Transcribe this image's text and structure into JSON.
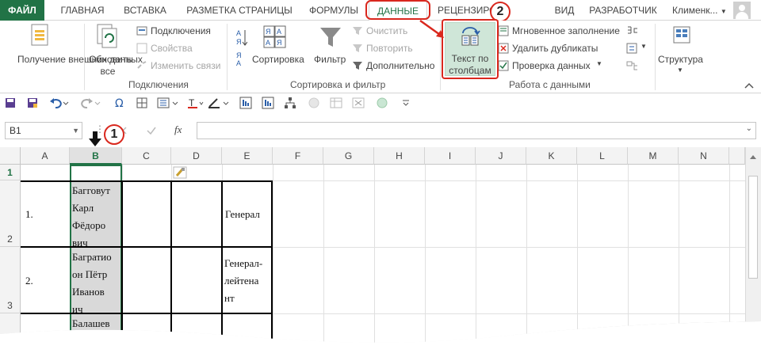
{
  "ribbon_tabs": {
    "file": "ФАЙЛ",
    "home": "ГЛАВНАЯ",
    "insert": "ВСТАВКА",
    "page_layout": "РАЗМЕТКА СТРАНИЦЫ",
    "formulas": "ФОРМУЛЫ",
    "data": "ДАННЫЕ",
    "review": "РЕЦЕНЗИРОВАНИЕ",
    "view": "ВИД",
    "developer": "РАЗРАБОТЧИК",
    "user": "Клименк...",
    "active": "data"
  },
  "ribbon": {
    "get_external": "Получение внешних данных",
    "refresh_all": "Обновить все",
    "connections": "Подключения",
    "properties": "Свойства",
    "edit_links": "Изменить связи",
    "connections_group": "Подключения",
    "sort": "Сортировка",
    "filter": "Фильтр",
    "clear": "Очистить",
    "reapply": "Повторить",
    "advanced": "Дополнительно",
    "sort_filter_group": "Сортировка и фильтр",
    "text_to_columns": "Текст по столбцам",
    "flash_fill": "Мгновенное заполнение",
    "remove_duplicates": "Удалить дубликаты",
    "data_validation": "Проверка данных",
    "data_tools_group": "Работа с данными",
    "outline": "Структура"
  },
  "badges": {
    "one": "1",
    "two": "2"
  },
  "formula_bar": {
    "name_box": "B1",
    "fx": "fx",
    "formula": ""
  },
  "columns": [
    "A",
    "B",
    "C",
    "D",
    "E",
    "F",
    "G",
    "H",
    "I",
    "J",
    "K",
    "L",
    "M",
    "N"
  ],
  "selected_column": "B",
  "rows": [
    "1",
    "2",
    "3"
  ],
  "cells": {
    "a2": "1.",
    "b2_lines": [
      "Багговут",
      "Карл",
      "Фёдоро",
      "вич"
    ],
    "e2": "Генерал",
    "a3": "2.",
    "b3_lines": [
      "Багратио",
      "он Пётр",
      "Иванов",
      "ич"
    ],
    "e3_lines": [
      "Генерал-",
      "лейтена",
      "нт"
    ],
    "b4": "Балашев"
  },
  "colors": {
    "excel_green": "#217346",
    "callout_red": "#d9281e",
    "selected_fill": "#d9d9d9"
  }
}
